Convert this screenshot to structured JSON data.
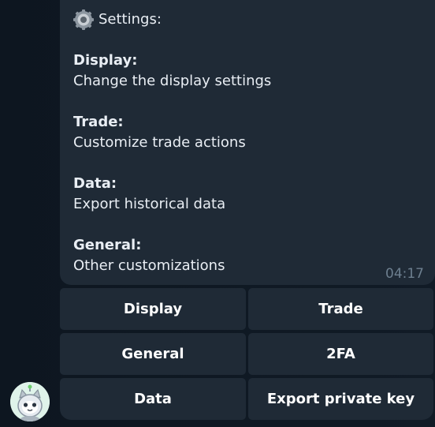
{
  "message": {
    "title": "Settings:",
    "icon": "gear-icon",
    "sections": [
      {
        "head": "Display:",
        "desc": "Change the display settings"
      },
      {
        "head": "Trade:",
        "desc": "Customize trade actions"
      },
      {
        "head": "Data:",
        "desc": "Export historical data"
      },
      {
        "head": "General:",
        "desc": "Other customizations"
      }
    ],
    "time": "04:17"
  },
  "keyboard": {
    "display": "Display",
    "trade": "Trade",
    "general": "General",
    "twofa": "2FA",
    "data": "Data",
    "export_key": "Export private key"
  },
  "avatar": {
    "icon": "cat-robot-avatar"
  }
}
